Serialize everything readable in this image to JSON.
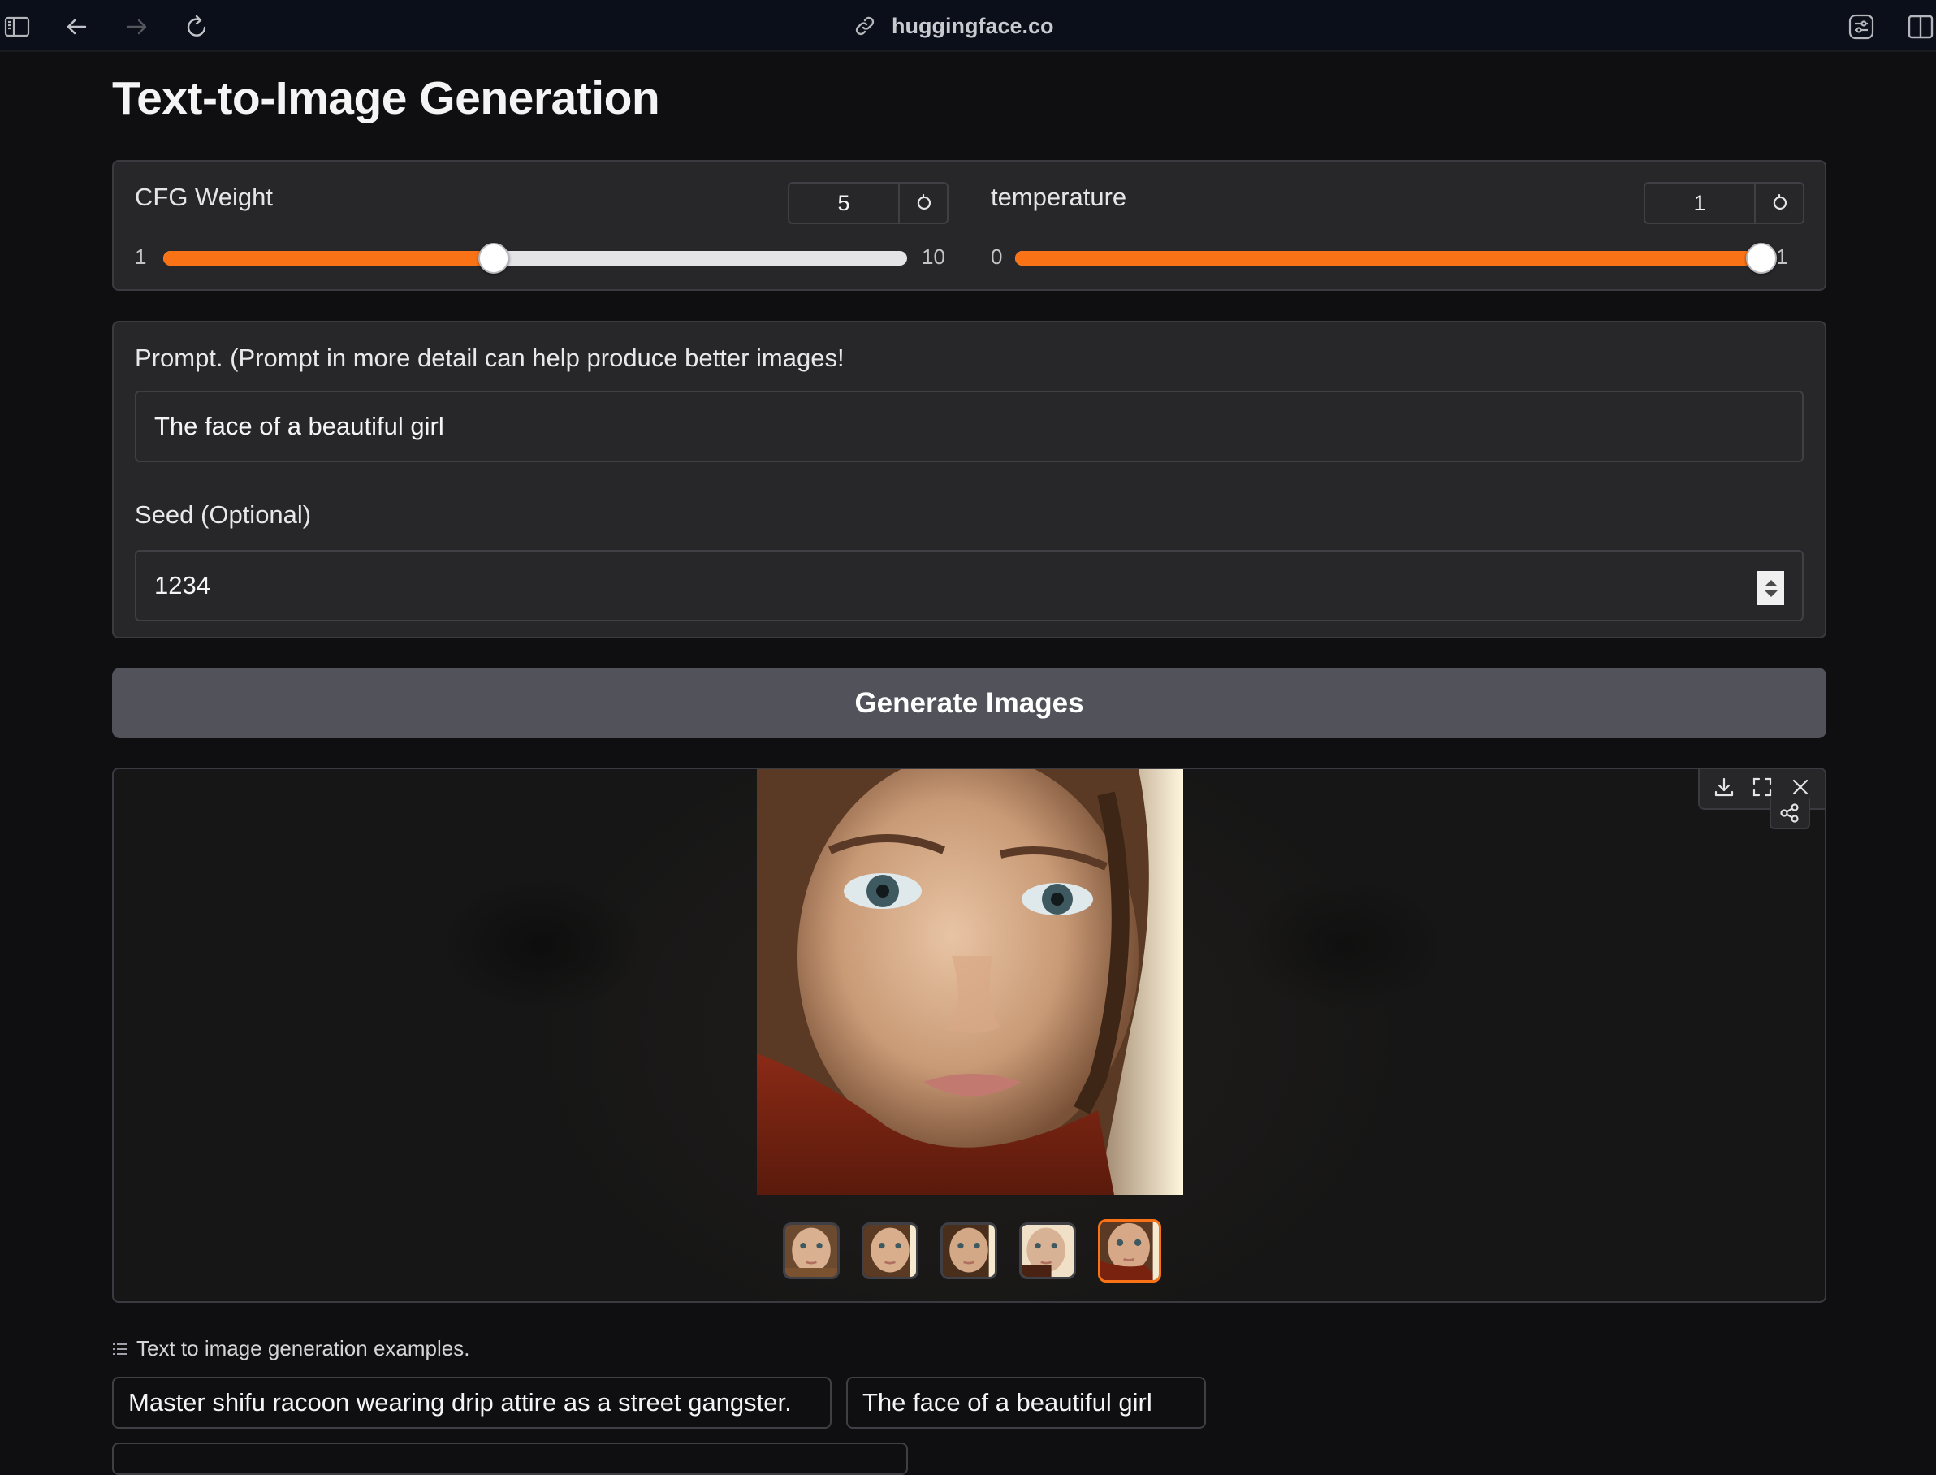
{
  "browser": {
    "url": "huggingface.co",
    "icons": [
      "sidebar-toggle-icon",
      "back-arrow-icon",
      "forward-arrow-icon",
      "reload-icon",
      "link-icon",
      "sliders-icon",
      "split-view-icon"
    ]
  },
  "page": {
    "title": "Text-to-Image Generation"
  },
  "sliders": [
    {
      "label": "CFG Weight",
      "value": "5",
      "min": 1,
      "max": 10,
      "min_label": "1",
      "max_label": "10",
      "current": 5
    },
    {
      "label": "temperature",
      "value": "1",
      "min": 0,
      "max": 1,
      "min_label": "0",
      "max_label": "1",
      "current": 1
    }
  ],
  "prompt": {
    "label": "Prompt. (Prompt in more detail can help produce better images!",
    "value": "The face of a beautiful girl"
  },
  "seed": {
    "label": "Seed (Optional)",
    "value": "1234"
  },
  "generate_button": {
    "label": "Generate Images"
  },
  "gallery": {
    "thumbnail_count": 5,
    "selected_index": 4,
    "tools": [
      "download-icon",
      "fullscreen-icon",
      "close-icon",
      "share-icon"
    ]
  },
  "examples": {
    "label": "Text to image generation examples.",
    "items": [
      "Master shifu racoon wearing drip attire as a street gangster.",
      "The face of a beautiful girl"
    ]
  },
  "colors": {
    "accent": "#f97316",
    "panel": "#27272a",
    "background": "#0f0f11",
    "button": "#52525b"
  }
}
